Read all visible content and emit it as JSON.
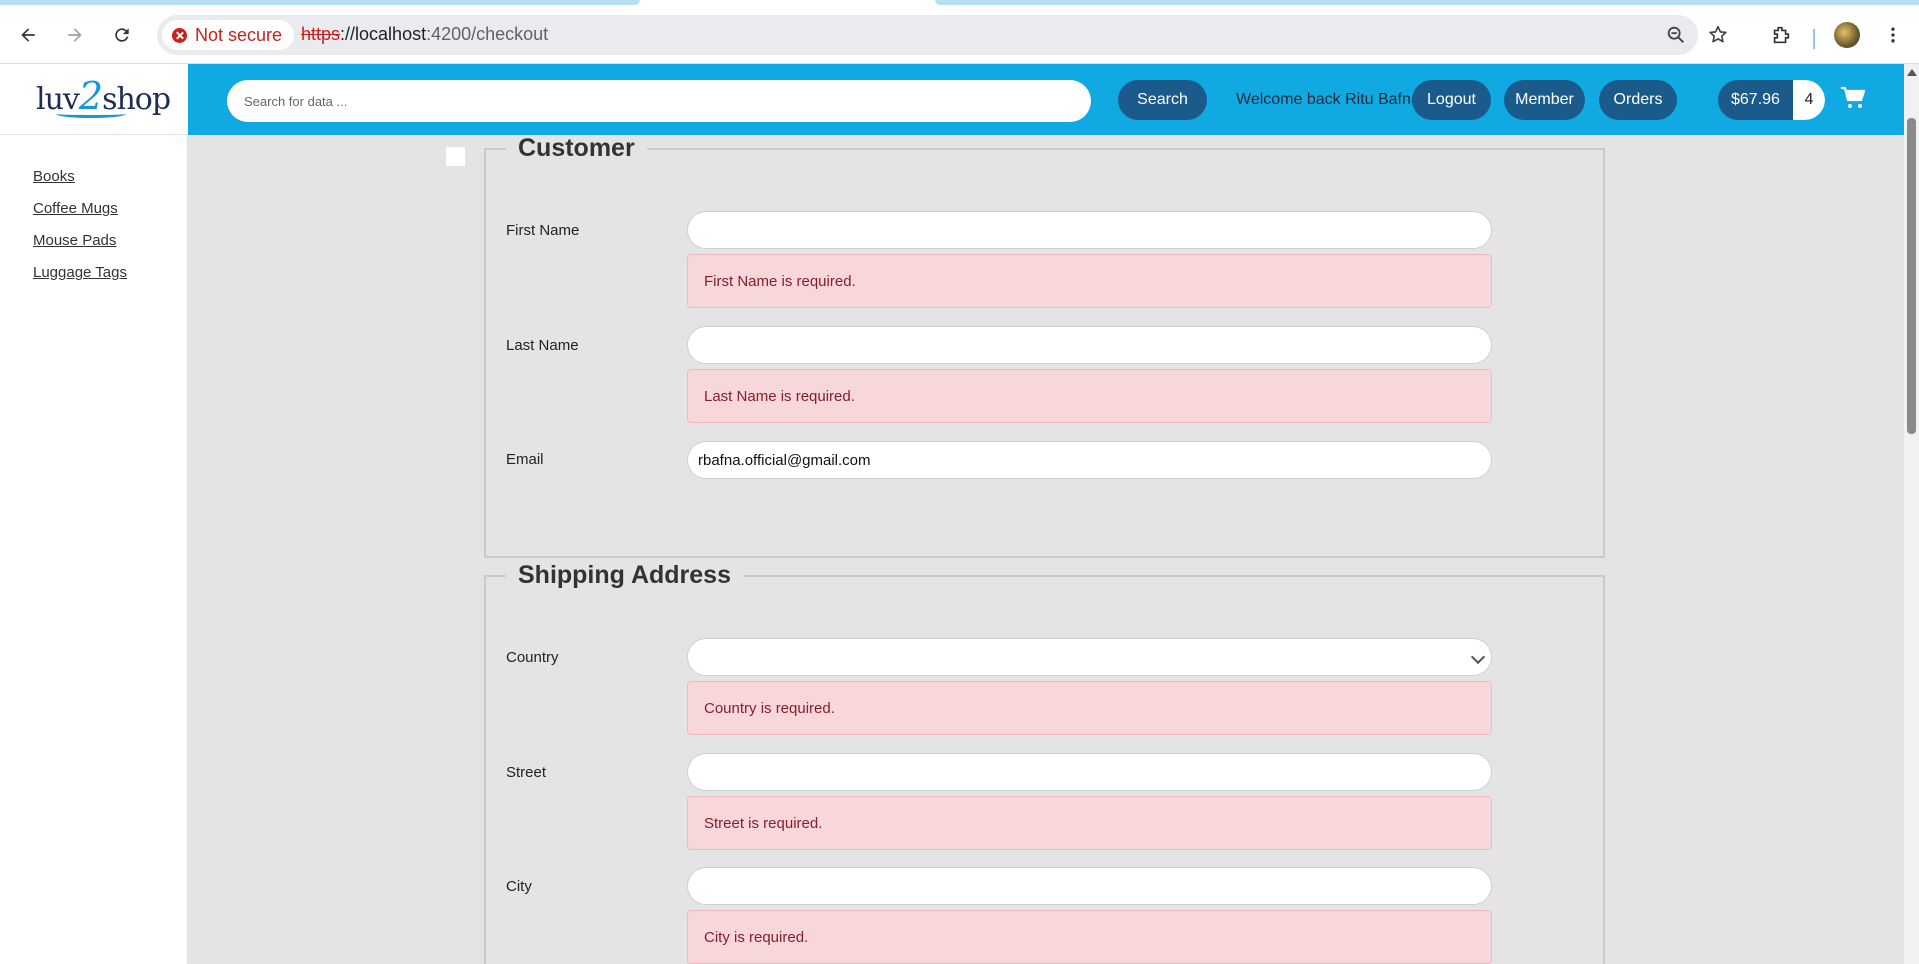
{
  "browser": {
    "security_label": "Not secure",
    "url_scheme": "https",
    "url_host": "://localhost",
    "url_path": ":4200/checkout",
    "icons": [
      "back-icon",
      "forward-icon",
      "reload-icon",
      "zoom-icon",
      "bookmark-star-icon",
      "extensions-icon",
      "profile-avatar",
      "kebab-menu-icon"
    ]
  },
  "header": {
    "logo": {
      "prefix": "luv",
      "two": "2",
      "suffix": "shop"
    },
    "search_placeholder": "Search for data ...",
    "search_button": "Search",
    "welcome": "Welcome back Ritu Bafna",
    "logout": "Logout",
    "member": "Member",
    "orders": "Orders",
    "cart_total": "$67.96",
    "cart_quantity": "4",
    "accent_color": "#10a9e2",
    "button_color": "#1a5b8c"
  },
  "sidebar": {
    "items": [
      {
        "label": "Books"
      },
      {
        "label": "Coffee Mugs"
      },
      {
        "label": "Mouse Pads"
      },
      {
        "label": "Luggage Tags"
      }
    ]
  },
  "customer": {
    "legend": "Customer",
    "first_name": {
      "label": "First Name",
      "value": "",
      "error": "First Name is required."
    },
    "last_name": {
      "label": "Last Name",
      "value": "",
      "error": "Last Name is required."
    },
    "email": {
      "label": "Email",
      "value": "rbafna.official@gmail.com"
    }
  },
  "shipping": {
    "legend": "Shipping Address",
    "country": {
      "label": "Country",
      "value": "",
      "error": "Country is required."
    },
    "street": {
      "label": "Street",
      "value": "",
      "error": "Street is required."
    },
    "city": {
      "label": "City",
      "value": "",
      "error": "City is required."
    }
  }
}
